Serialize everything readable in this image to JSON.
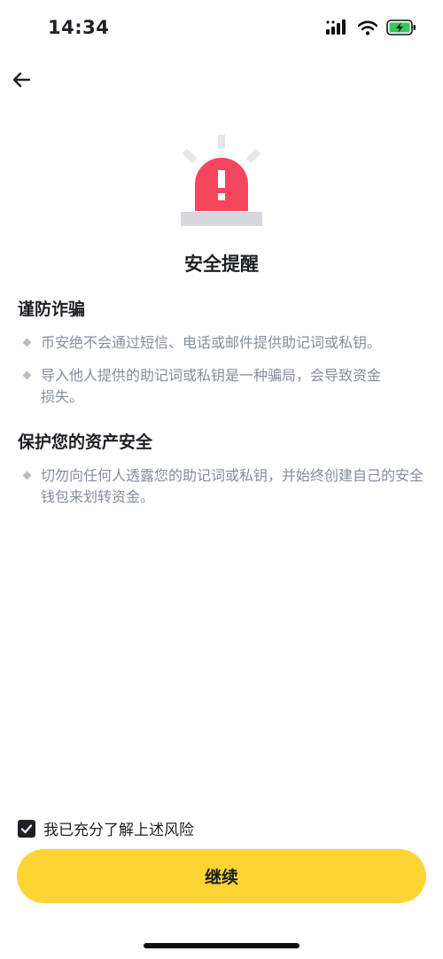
{
  "status_bar": {
    "time": "14:34"
  },
  "header": {
    "back_icon": "arrow-left-icon"
  },
  "hero": {
    "icon": "alarm-siren-icon",
    "siren_color": "#f6465d",
    "title": "安全提醒"
  },
  "sections": [
    {
      "title": "谨防诈骗",
      "items": [
        "币安绝不会通过短信、电话或邮件提供助记词或私钥。",
        "导入他人提供的助记词或私钥是一种骗局，会导致资金损失。"
      ]
    },
    {
      "title": "保护您的资产安全",
      "items": [
        "切勿向任何人透露您的助记词或私钥，并始终创建自己的安全钱包来划转资金。"
      ]
    }
  ],
  "agreement": {
    "checked": true,
    "label": "我已充分了解上述风险"
  },
  "footer": {
    "continue_label": "继续",
    "button_color": "#fcd535"
  }
}
